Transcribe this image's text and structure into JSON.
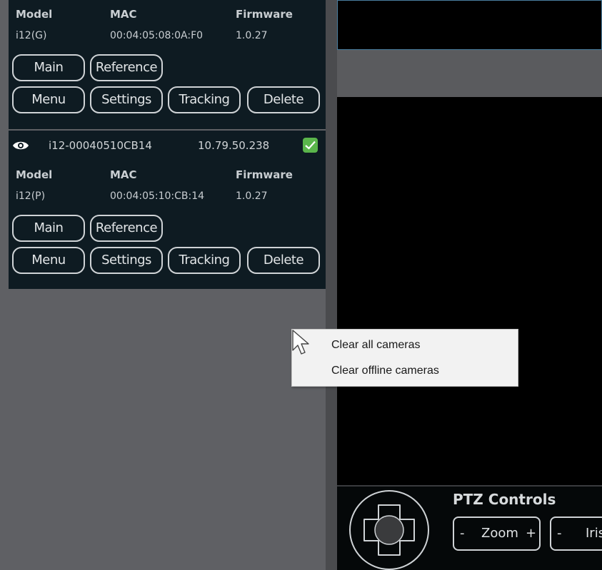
{
  "camera_list": {
    "headers": {
      "model": "Model",
      "mac": "MAC",
      "firmware": "Firmware"
    },
    "cameras": [
      {
        "model": "i12(G)",
        "mac": "00:04:05:08:0A:F0",
        "firmware": "1.0.27"
      },
      {
        "name": "i12-00040510CB14",
        "ip": "10.79.50.238",
        "online": true,
        "model": "i12(P)",
        "mac": "00:04:05:10:CB:14",
        "firmware": "1.0.27"
      }
    ],
    "buttons": {
      "main": "Main",
      "reference": "Reference",
      "menu": "Menu",
      "settings": "Settings",
      "tracking": "Tracking",
      "delete": "Delete"
    }
  },
  "context_menu": {
    "items": [
      "Clear all cameras",
      "Clear offline cameras"
    ]
  },
  "ptz": {
    "title": "PTZ Controls",
    "zoom": {
      "minus": "-",
      "label": "Zoom",
      "plus": "+"
    },
    "iris": {
      "minus": "-",
      "label": "Iris"
    }
  },
  "colors": {
    "card_bg": "#0e1b22",
    "online_check": "#5ab54b",
    "panel_bg": "#5f6064",
    "video_bg": "#000000"
  }
}
